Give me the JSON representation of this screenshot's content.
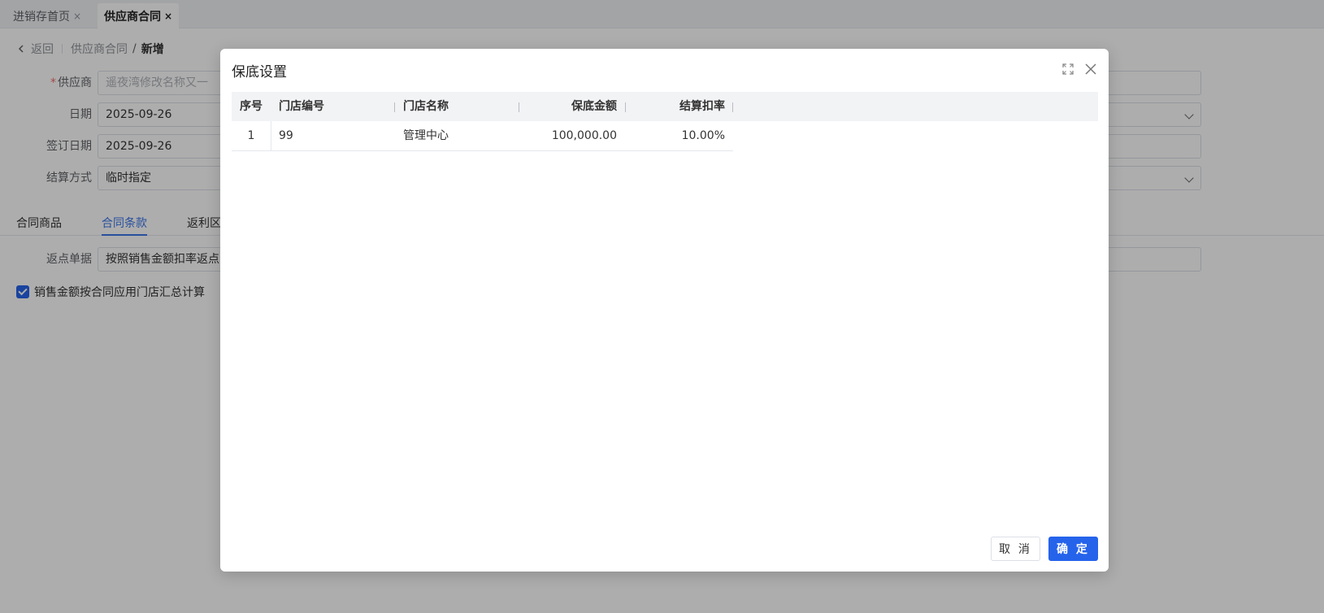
{
  "page_tabs": [
    {
      "label": "进销存首页",
      "close": "×"
    },
    {
      "label": "供应商合同",
      "close": "×"
    }
  ],
  "breadcrumb": {
    "back": "返回",
    "parent": "供应商合同",
    "separator": "/",
    "current": "新增"
  },
  "form": {
    "supplier": {
      "label": "供应商",
      "required_mark": "*",
      "placeholder": "遥夜湾修改名称又一"
    },
    "date": {
      "label": "日期",
      "value": "2025-09-26"
    },
    "sign_date": {
      "label": "签订日期",
      "value": "2025-09-26"
    },
    "settle_method": {
      "label": "结算方式",
      "value": "临时指定"
    },
    "rebate_doc": {
      "label": "返点单据",
      "value": "按照销售金额扣率返点"
    }
  },
  "sub_tabs": [
    {
      "label": "合同商品",
      "active": false
    },
    {
      "label": "合同条款",
      "active": true
    },
    {
      "label": "返利区间",
      "active": false
    }
  ],
  "checkbox": {
    "label": "销售金额按合同应用门店汇总计算",
    "checked": true
  },
  "dialog": {
    "title": "保底设置",
    "columns": {
      "index": "序号",
      "store_code": "门店编号",
      "store_name": "门店名称",
      "guarantee_amount": "保底金额",
      "settle_rate": "结算扣率"
    },
    "rows": [
      {
        "index": "1",
        "store_code": "99",
        "store_name": "管理中心",
        "guarantee_amount": "100,000.00",
        "settle_rate": "10.00%"
      }
    ],
    "cancel_label": "取 消",
    "ok_label": "确 定"
  },
  "colors": {
    "primary": "#2563eb",
    "active_tab": "#3c76e8",
    "required": "#f56c6c"
  }
}
